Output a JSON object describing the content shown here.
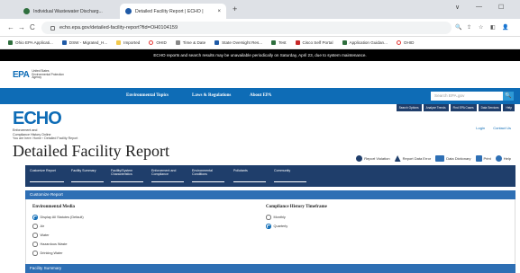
{
  "browser": {
    "tabs": [
      {
        "title": "Individual Wastewater Discharg...",
        "active": false,
        "favicon_color": "#2f6f3e"
      },
      {
        "title": "Detailed Facility Report | ECHO |",
        "active": true,
        "favicon_color": "#1f5aa6"
      }
    ],
    "new_tab_label": "+",
    "close_label": "×",
    "window_controls": [
      "∨",
      "—",
      "☐"
    ],
    "url": "echo.epa.gov/detailed-facility-report?fid=OH0104159",
    "nav": {
      "back": "←",
      "forward": "→",
      "reload": "C"
    },
    "right_icons": [
      "🔍",
      "⇪",
      "☆",
      "◧",
      "👤"
    ]
  },
  "bookmarks": [
    {
      "label": "Ohio EPA Applicati...",
      "color": "#2f6f3e"
    },
    {
      "label": "DSW - Migrated_H...",
      "color": "#1f5aa6"
    },
    {
      "label": "Imported",
      "color": "#f2c94c"
    },
    {
      "label": "OHID",
      "color": "#e53935"
    },
    {
      "label": "Time & Date",
      "color": "#888888"
    },
    {
      "label": "State Oversight Res...",
      "color": "#1f5aa6"
    },
    {
      "label": "Test",
      "color": "#2f6f3e"
    },
    {
      "label": "Cisco Self Portal",
      "color": "#c62828"
    },
    {
      "label": "Application Guidan...",
      "color": "#2f6f3e"
    },
    {
      "label": "OHID",
      "color": "#e53935"
    }
  ],
  "alert": "ECHO reports and search results may be unavailable periodically on Saturday, April 23, due to system maintenance.",
  "epa": {
    "logo_text": "EPA",
    "logo_sub": "United States Environmental Protection Agency",
    "nav": [
      "Environmental Topics",
      "Laws & Regulations",
      "About EPA"
    ],
    "search_placeholder": "Search EPA.gov",
    "search_button": "🔍"
  },
  "echo": {
    "logo_text": "ECHO",
    "logo_sub_1": "Enforcement and",
    "logo_sub_2": "Compliance History Online",
    "breadcrumb": "You are here: Home › Detailed Facility Report",
    "tool_buttons": [
      "Search Options",
      "Analyze Trends",
      "Find EPA Cases",
      "Data Services",
      "Help"
    ],
    "top_links": [
      "Login",
      "Contact Us"
    ]
  },
  "page": {
    "title": "Detailed Facility Report",
    "actions": [
      "Report Violation",
      "Report Data Error",
      "Data Dictionary",
      "Print",
      "Help"
    ]
  },
  "report_tabs": [
    "Customize Report",
    "Facility Summary",
    "Facility/System Characteristics",
    "Enforcement and Compliance",
    "Environmental Conditions",
    "Pollutants",
    "Community"
  ],
  "customize": {
    "header": "Customize Report",
    "media_heading": "Environmental Media",
    "media_options": [
      {
        "label": "Display All Statutes (Default)",
        "selected": true
      },
      {
        "label": "Air",
        "selected": false
      },
      {
        "label": "Water",
        "selected": false
      },
      {
        "label": "Hazardous Waste",
        "selected": false
      },
      {
        "label": "Drinking Water",
        "selected": false
      }
    ],
    "timeframe_heading": "Compliance History Timeframe",
    "timeframe_options": [
      {
        "label": "Monthly",
        "selected": false
      },
      {
        "label": "Quarterly",
        "selected": true
      }
    ]
  },
  "facility_summary_header": "Facility Summary",
  "colors": {
    "epa_blue": "#0e6cb6",
    "nav_navy": "#1f3e6b",
    "section_blue": "#2e6fb4"
  }
}
